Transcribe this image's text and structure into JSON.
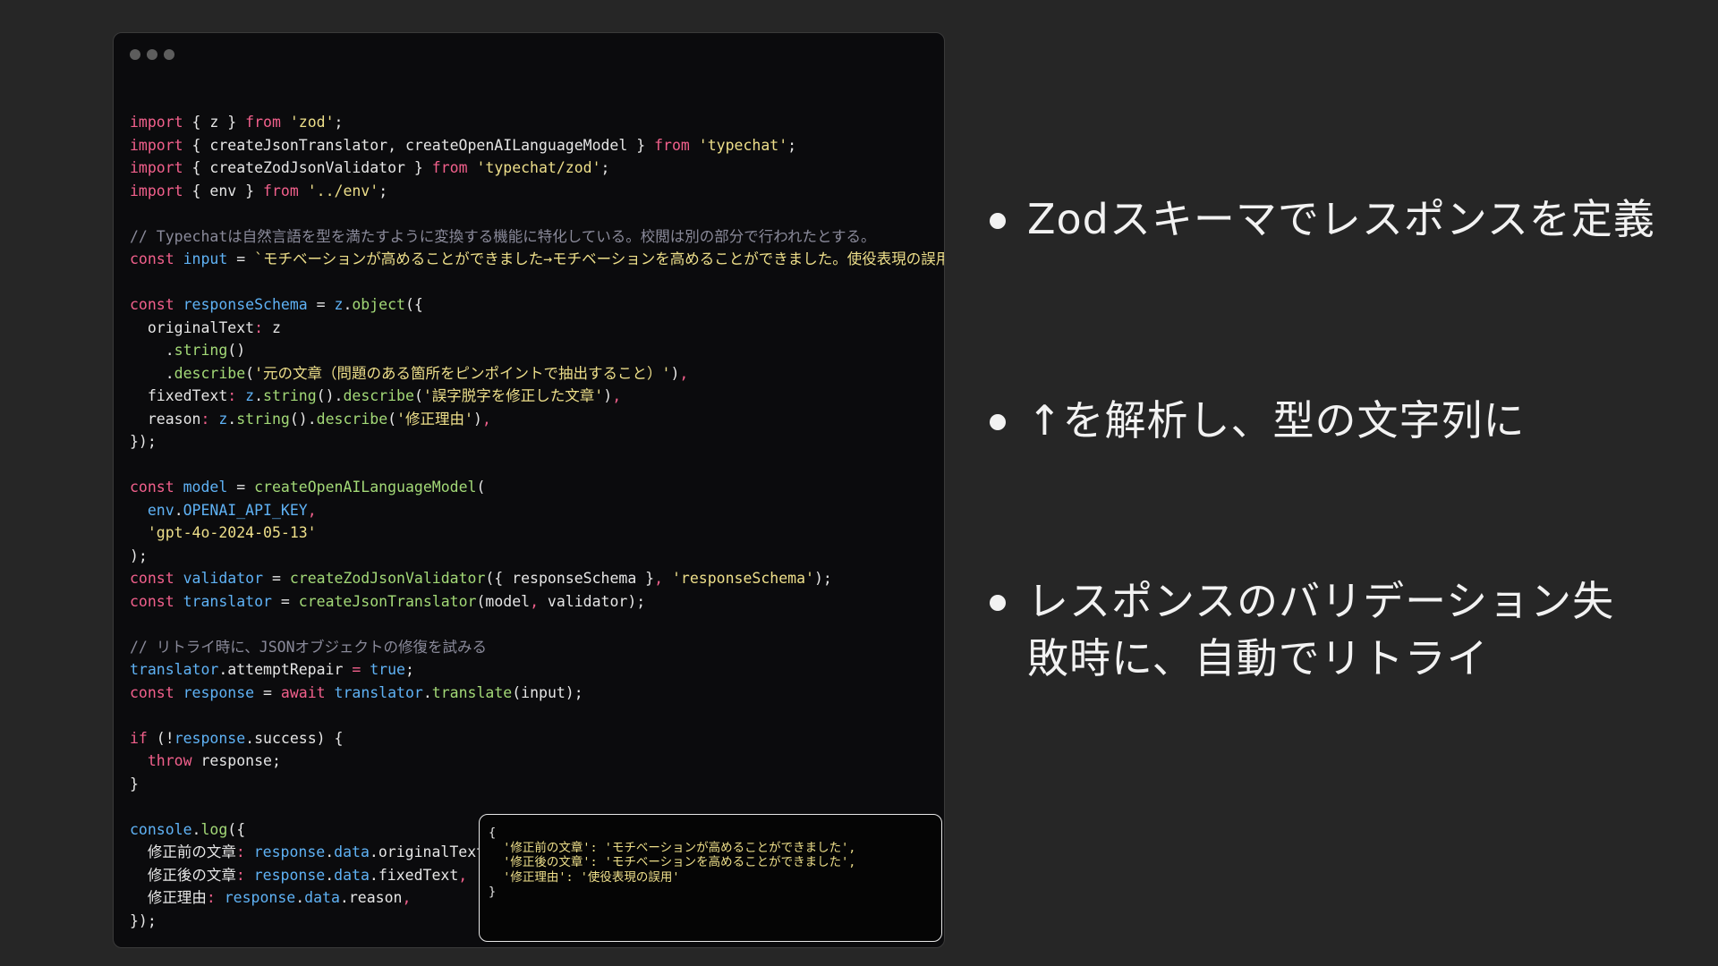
{
  "code_window": {
    "lines": [
      [
        [
          "kw",
          "import"
        ],
        [
          "plain",
          " { z } "
        ],
        [
          "kw",
          "from"
        ],
        [
          "plain",
          " "
        ],
        [
          "str",
          "'zod'"
        ],
        [
          "plain",
          ";"
        ]
      ],
      [
        [
          "kw",
          "import"
        ],
        [
          "plain",
          " { createJsonTranslator, createOpenAILanguageModel } "
        ],
        [
          "kw",
          "from"
        ],
        [
          "plain",
          " "
        ],
        [
          "str",
          "'typechat'"
        ],
        [
          "plain",
          ";"
        ]
      ],
      [
        [
          "kw",
          "import"
        ],
        [
          "plain",
          " { createZodJsonValidator } "
        ],
        [
          "kw",
          "from"
        ],
        [
          "plain",
          " "
        ],
        [
          "str",
          "'typechat/zod'"
        ],
        [
          "plain",
          ";"
        ]
      ],
      [
        [
          "kw",
          "import"
        ],
        [
          "plain",
          " { env } "
        ],
        [
          "kw",
          "from"
        ],
        [
          "plain",
          " "
        ],
        [
          "str",
          "'../env'"
        ],
        [
          "plain",
          ";"
        ]
      ],
      [],
      [
        [
          "cmt",
          "// Typechatは自然言語を型を満たすように変換する機能に特化している。校閲は別の部分で行われたとする。"
        ]
      ],
      [
        [
          "kw",
          "const"
        ],
        [
          "plain",
          " "
        ],
        [
          "var",
          "input"
        ],
        [
          "plain",
          " = "
        ],
        [
          "str",
          "`モチベーションが高めることができました→モチベーションを高めることができました。使役表現の誤用`"
        ],
        [
          "plain",
          ";"
        ]
      ],
      [],
      [
        [
          "kw",
          "const"
        ],
        [
          "plain",
          " "
        ],
        [
          "var",
          "responseSchema"
        ],
        [
          "plain",
          " = "
        ],
        [
          "var",
          "z"
        ],
        [
          "plain",
          "."
        ],
        [
          "fn",
          "object"
        ],
        [
          "plain",
          "({"
        ]
      ],
      [
        [
          "plain",
          "  originalText"
        ],
        [
          "kw",
          ":"
        ],
        [
          "plain",
          " z"
        ]
      ],
      [
        [
          "plain",
          "    ."
        ],
        [
          "fn",
          "string"
        ],
        [
          "plain",
          "()"
        ]
      ],
      [
        [
          "plain",
          "    ."
        ],
        [
          "fn",
          "describe"
        ],
        [
          "plain",
          "("
        ],
        [
          "str",
          "'元の文章（問題のある箇所をピンポイントで抽出すること）'"
        ],
        [
          "plain",
          ")"
        ],
        [
          "kw",
          ","
        ]
      ],
      [
        [
          "plain",
          "  fixedText"
        ],
        [
          "kw",
          ":"
        ],
        [
          "plain",
          " "
        ],
        [
          "var",
          "z"
        ],
        [
          "plain",
          "."
        ],
        [
          "fn",
          "string"
        ],
        [
          "plain",
          "()."
        ],
        [
          "fn",
          "describe"
        ],
        [
          "plain",
          "("
        ],
        [
          "str",
          "'誤字脱字を修正した文章'"
        ],
        [
          "plain",
          ")"
        ],
        [
          "kw",
          ","
        ]
      ],
      [
        [
          "plain",
          "  reason"
        ],
        [
          "kw",
          ":"
        ],
        [
          "plain",
          " "
        ],
        [
          "var",
          "z"
        ],
        [
          "plain",
          "."
        ],
        [
          "fn",
          "string"
        ],
        [
          "plain",
          "()."
        ],
        [
          "fn",
          "describe"
        ],
        [
          "plain",
          "("
        ],
        [
          "str",
          "'修正理由'"
        ],
        [
          "plain",
          ")"
        ],
        [
          "kw",
          ","
        ]
      ],
      [
        [
          "plain",
          "});"
        ]
      ],
      [],
      [
        [
          "kw",
          "const"
        ],
        [
          "plain",
          " "
        ],
        [
          "var",
          "model"
        ],
        [
          "plain",
          " = "
        ],
        [
          "fn",
          "createOpenAILanguageModel"
        ],
        [
          "plain",
          "("
        ]
      ],
      [
        [
          "plain",
          "  "
        ],
        [
          "var",
          "env"
        ],
        [
          "plain",
          "."
        ],
        [
          "var",
          "OPENAI_API_KEY"
        ],
        [
          "kw",
          ","
        ]
      ],
      [
        [
          "plain",
          "  "
        ],
        [
          "str",
          "'gpt-4o-2024-05-13'"
        ]
      ],
      [
        [
          "plain",
          ");"
        ]
      ],
      [
        [
          "kw",
          "const"
        ],
        [
          "plain",
          " "
        ],
        [
          "var",
          "validator"
        ],
        [
          "plain",
          " = "
        ],
        [
          "fn",
          "createZodJsonValidator"
        ],
        [
          "plain",
          "({ responseSchema }"
        ],
        [
          "kw",
          ","
        ],
        [
          "plain",
          " "
        ],
        [
          "str",
          "'responseSchema'"
        ],
        [
          "plain",
          ");"
        ]
      ],
      [
        [
          "kw",
          "const"
        ],
        [
          "plain",
          " "
        ],
        [
          "var",
          "translator"
        ],
        [
          "plain",
          " = "
        ],
        [
          "fn",
          "createJsonTranslator"
        ],
        [
          "plain",
          "(model"
        ],
        [
          "kw",
          ","
        ],
        [
          "plain",
          " validator);"
        ]
      ],
      [],
      [
        [
          "cmt",
          "// リトライ時に、JSONオブジェクトの修復を試みる"
        ]
      ],
      [
        [
          "var",
          "translator"
        ],
        [
          "plain",
          ".attemptRepair "
        ],
        [
          "kw",
          "="
        ],
        [
          "plain",
          " "
        ],
        [
          "var",
          "true"
        ],
        [
          "plain",
          ";"
        ]
      ],
      [
        [
          "kw",
          "const"
        ],
        [
          "plain",
          " "
        ],
        [
          "var",
          "response"
        ],
        [
          "plain",
          " = "
        ],
        [
          "kw",
          "await"
        ],
        [
          "plain",
          " "
        ],
        [
          "var",
          "translator"
        ],
        [
          "plain",
          "."
        ],
        [
          "fn",
          "translate"
        ],
        [
          "plain",
          "(input);"
        ]
      ],
      [],
      [
        [
          "kw",
          "if"
        ],
        [
          "plain",
          " (!"
        ],
        [
          "var",
          "response"
        ],
        [
          "plain",
          ".success) {"
        ]
      ],
      [
        [
          "plain",
          "  "
        ],
        [
          "kw",
          "throw"
        ],
        [
          "plain",
          " response;"
        ]
      ],
      [
        [
          "plain",
          "}"
        ]
      ],
      [],
      [
        [
          "var",
          "console"
        ],
        [
          "plain",
          "."
        ],
        [
          "fn",
          "log"
        ],
        [
          "plain",
          "({"
        ]
      ],
      [
        [
          "plain",
          "  修正前の文章"
        ],
        [
          "kw",
          ":"
        ],
        [
          "plain",
          " "
        ],
        [
          "var",
          "response"
        ],
        [
          "plain",
          "."
        ],
        [
          "var",
          "data"
        ],
        [
          "plain",
          ".originalText"
        ],
        [
          "kw",
          ","
        ]
      ],
      [
        [
          "plain",
          "  修正後の文章"
        ],
        [
          "kw",
          ":"
        ],
        [
          "plain",
          " "
        ],
        [
          "var",
          "response"
        ],
        [
          "plain",
          "."
        ],
        [
          "var",
          "data"
        ],
        [
          "plain",
          ".fixedText"
        ],
        [
          "kw",
          ","
        ]
      ],
      [
        [
          "plain",
          "  修正理由"
        ],
        [
          "kw",
          ":"
        ],
        [
          "plain",
          " "
        ],
        [
          "var",
          "response"
        ],
        [
          "plain",
          "."
        ],
        [
          "var",
          "data"
        ],
        [
          "plain",
          ".reason"
        ],
        [
          "kw",
          ","
        ]
      ],
      [
        [
          "plain",
          "});"
        ]
      ]
    ]
  },
  "output": {
    "open": "{",
    "line1": "  '修正前の文章': 'モチベーションが高めることができました',",
    "line2": "  '修正後の文章': 'モチベーションを高めることができました',",
    "line3": "  '修正理由': '使役表現の誤用'",
    "close": "}"
  },
  "bullets": [
    "Zodスキーマでレスポンスを定義",
    "↑を解析し、型の文字列に",
    "レスポンスのバリデーション失敗時に、自動でリトライ"
  ],
  "colors": {
    "background": "#262626",
    "code_background": "#0b0b0d",
    "keyword": "#f2608c",
    "string": "#eedf8a",
    "identifier": "#5fb2f5",
    "function": "#a3d977",
    "comment": "#8a8a9a"
  }
}
